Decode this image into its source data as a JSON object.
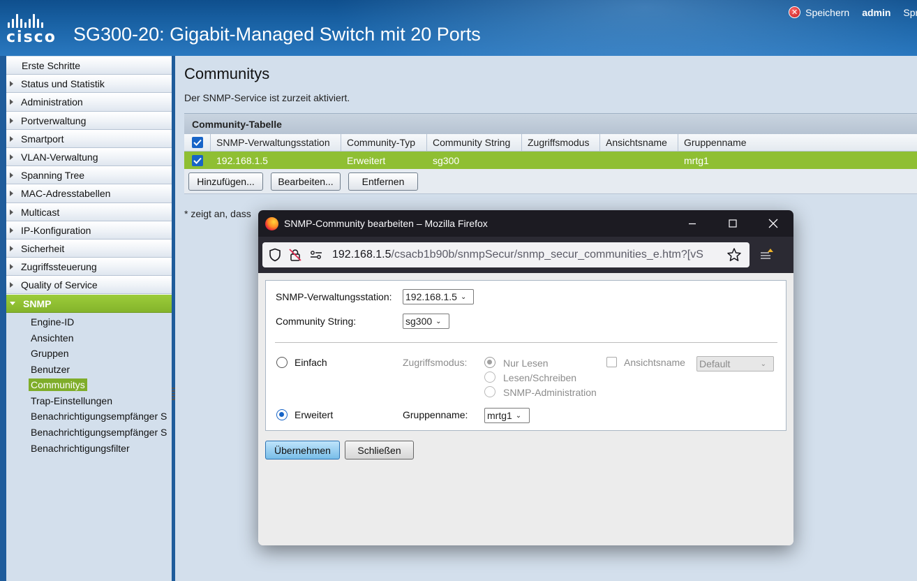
{
  "header": {
    "logo_text": "cisco",
    "title": "SG300-20: Gigabit-Managed Switch mit 20 Ports",
    "save_label": "Speichern",
    "user": "admin",
    "language": "Spra"
  },
  "sidebar": {
    "items": [
      {
        "label": "Erste Schritte"
      },
      {
        "label": "Status und Statistik"
      },
      {
        "label": "Administration"
      },
      {
        "label": "Portverwaltung"
      },
      {
        "label": "Smartport"
      },
      {
        "label": "VLAN-Verwaltung"
      },
      {
        "label": "Spanning Tree"
      },
      {
        "label": "MAC-Adresstabellen"
      },
      {
        "label": "Multicast"
      },
      {
        "label": "IP-Konfiguration"
      },
      {
        "label": "Sicherheit"
      },
      {
        "label": "Zugriffssteuerung"
      },
      {
        "label": "Quality of Service"
      },
      {
        "label": "SNMP"
      }
    ],
    "snmp_sub": [
      {
        "label": "Engine-ID"
      },
      {
        "label": "Ansichten"
      },
      {
        "label": "Gruppen"
      },
      {
        "label": "Benutzer"
      },
      {
        "label": "Communitys"
      },
      {
        "label": "Trap-Einstellungen"
      },
      {
        "label": "Benachrichtigungsempfänger S"
      },
      {
        "label": "Benachrichtigungsempfänger S"
      },
      {
        "label": "Benachrichtigungsfilter"
      }
    ]
  },
  "main": {
    "title": "Communitys",
    "status": "Der SNMP-Service ist zurzeit aktiviert.",
    "table": {
      "caption": "Community-Tabelle",
      "columns": [
        "SNMP-Verwaltungsstation",
        "Community-Typ",
        "Community String",
        "Zugriffsmodus",
        "Ansichtsname",
        "Gruppenname"
      ],
      "rows": [
        {
          "station": "192.168.1.5",
          "type": "Erweitert",
          "community": "sg300",
          "access": "",
          "view": "",
          "group": "mrtg1"
        }
      ],
      "buttons": {
        "add": "Hinzufügen...",
        "edit": "Bearbeiten...",
        "delete": "Entfernen"
      }
    },
    "note": "* zeigt an, dass"
  },
  "popup": {
    "window_title": "SNMP-Community bearbeiten – Mozilla Firefox",
    "url_host": "192.168.1.5",
    "url_path": "/csacb1b90b/snmpSecur/snmp_secur_communities_e.htm?[vS",
    "form": {
      "station_label": "SNMP-Verwaltungsstation:",
      "station_value": "192.168.1.5",
      "community_label": "Community String:",
      "community_value": "sg300",
      "simple_label": "Einfach",
      "access_label": "Zugriffsmodus:",
      "access_options": [
        "Nur Lesen",
        "Lesen/Schreiben",
        "SNMP-Administration"
      ],
      "view_label": "Ansichtsname",
      "view_value": "Default",
      "advanced_label": "Erweitert",
      "group_label": "Gruppenname:",
      "group_value": "mrtg1"
    },
    "buttons": {
      "apply": "Übernehmen",
      "close": "Schließen"
    }
  }
}
